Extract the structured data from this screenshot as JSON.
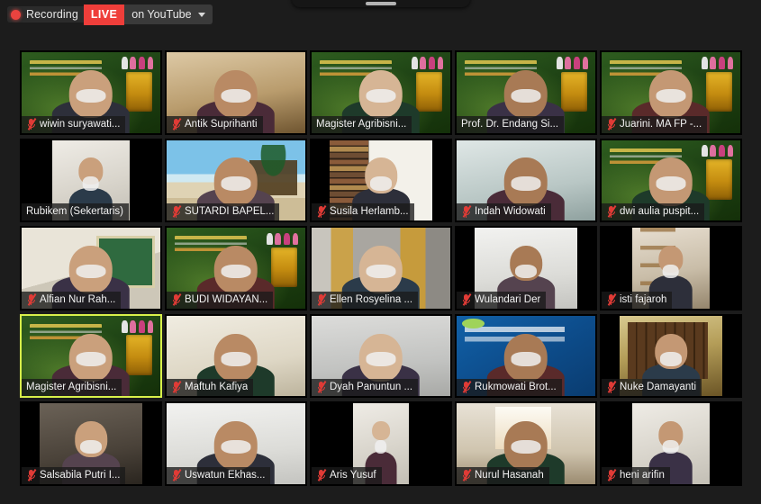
{
  "window": {
    "title": "Zoom Meeting Gallery View",
    "background_color": "#1c1c1c"
  },
  "top_bar": {
    "recording_label": "Recording",
    "recording_icon": "record-dot-icon",
    "live_badge": "LIVE",
    "stream_target": "on YouTube",
    "dropdown_icon": "chevron-down-icon",
    "live_color": "#ef3e3a"
  },
  "floating_panel": {
    "handle_icon": "drag-handle-icon"
  },
  "gallery": {
    "columns": 5,
    "rows": 5,
    "active_speaker_border_color": "#d8f04a",
    "mic_muted_icon": "microphone-muted-icon",
    "participants": [
      {
        "name": "wiwin suryawati...",
        "muted": true,
        "active": false,
        "scene": "bg-webinar",
        "fit": "full",
        "branded": true
      },
      {
        "name": "Antik Suprihanti",
        "muted": true,
        "active": false,
        "scene": "bg-room-warm",
        "fit": "full",
        "branded": false
      },
      {
        "name": "Magister Agribisni...",
        "muted": false,
        "active": false,
        "scene": "bg-webinar",
        "fit": "full",
        "branded": true
      },
      {
        "name": "Prof. Dr. Endang Si...",
        "muted": false,
        "active": false,
        "scene": "bg-webinar",
        "fit": "full",
        "branded": true
      },
      {
        "name": "Juarini. MA FP -...",
        "muted": true,
        "active": false,
        "scene": "bg-webinar",
        "fit": "full",
        "branded": true
      },
      {
        "name": "Rubikem (Sekertaris)",
        "muted": false,
        "active": false,
        "scene": "bg-room-white",
        "fit": "pillar",
        "branded": false
      },
      {
        "name": "SUTARDI BAPEL...",
        "muted": true,
        "active": false,
        "scene": "bg-beach",
        "fit": "full",
        "branded": false
      },
      {
        "name": "Susila Herlamb...",
        "muted": true,
        "active": false,
        "scene": "bg-bookshelf",
        "fit": "pillar-sm",
        "branded": false
      },
      {
        "name": "Indah Widowati",
        "muted": true,
        "active": false,
        "scene": "bg-teal-wall",
        "fit": "full",
        "branded": false
      },
      {
        "name": "dwi aulia puspit...",
        "muted": true,
        "active": false,
        "scene": "bg-webinar",
        "fit": "full",
        "branded": true
      },
      {
        "name": "Alfian Nur Rah...",
        "muted": true,
        "active": false,
        "scene": "bg-green-board",
        "fit": "full",
        "branded": false
      },
      {
        "name": "BUDI WIDAYAN...",
        "muted": true,
        "active": false,
        "scene": "bg-webinar",
        "fit": "full",
        "branded": true
      },
      {
        "name": "Ellen Rosyelina ...",
        "muted": true,
        "active": false,
        "scene": "bg-curtain-gold",
        "fit": "full",
        "branded": false
      },
      {
        "name": "Wulandari Der",
        "muted": true,
        "active": false,
        "scene": "bg-plain-lt",
        "fit": "pillar-sm",
        "branded": false
      },
      {
        "name": "isti fajaroh",
        "muted": true,
        "active": false,
        "scene": "bg-wood",
        "fit": "pillar",
        "branded": false
      },
      {
        "name": "Magister Agribisni...",
        "muted": false,
        "active": true,
        "scene": "bg-webinar",
        "fit": "full",
        "branded": true
      },
      {
        "name": "Maftuh Kafiya",
        "muted": true,
        "active": false,
        "scene": "bg-room-cream",
        "fit": "full",
        "branded": false
      },
      {
        "name": "Dyah Panuntun ...",
        "muted": true,
        "active": false,
        "scene": "bg-room-grey",
        "fit": "full",
        "branded": false
      },
      {
        "name": "Rukmowati Brot...",
        "muted": true,
        "active": false,
        "scene": "bg-blue-vbg",
        "fit": "full",
        "branded": false
      },
      {
        "name": "Nuke Damayanti",
        "muted": true,
        "active": false,
        "scene": "bg-cabinet",
        "fit": "pillar-sm",
        "branded": false
      },
      {
        "name": "Salsabila Putri I...",
        "muted": true,
        "active": false,
        "scene": "bg-room-dark",
        "fit": "pillar-sm",
        "branded": false
      },
      {
        "name": "Uswatun Ekhas...",
        "muted": true,
        "active": false,
        "scene": "bg-plain-lt",
        "fit": "full",
        "branded": false
      },
      {
        "name": "Aris Yusuf",
        "muted": true,
        "active": false,
        "scene": "bg-room-white",
        "fit": "pillar-lg",
        "branded": false
      },
      {
        "name": "Nurul Hasanah",
        "muted": true,
        "active": false,
        "scene": "bg-window",
        "fit": "full",
        "branded": false
      },
      {
        "name": "heni arifin",
        "muted": true,
        "active": false,
        "scene": "bg-room-white",
        "fit": "pillar",
        "branded": false
      }
    ]
  }
}
